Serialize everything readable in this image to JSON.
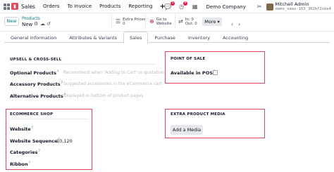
{
  "nav": {
    "app_name": "Sales",
    "menu": [
      "Orders",
      "To Invoice",
      "Products",
      "Reporting"
    ],
    "plus": "+",
    "chat_badge": "5",
    "activity_badge": "9",
    "company": "Demo Company",
    "user_name": "Mitchell Admin",
    "db_name": "demo_saas-163_302bf2cbe4"
  },
  "control": {
    "new_label": "New",
    "breadcrumb": "Products",
    "record_title": "New",
    "extra_prices_label": "Extra Prices",
    "extra_prices_count": "0",
    "website_line1": "Go to",
    "website_line2": "Website",
    "in_label": "In:",
    "in_value": "0",
    "out_label": "Out:",
    "out_value": "0",
    "more_label": "More"
  },
  "tabs": [
    "General Information",
    "Attributes & Variants",
    "Sales",
    "Purchase",
    "Inventory",
    "Accounting"
  ],
  "active_tab": "Sales",
  "upsell": {
    "title": "UPSELL & CROSS-SELL",
    "optional_label": "Optional Products",
    "optional_placeholder": "Recommend when 'Adding to Cart' or quotation",
    "accessory_label": "Accessory Products",
    "accessory_placeholder": "Suggested accessories in the eCommerce cart",
    "alternative_label": "Alternative Products",
    "alternative_placeholder": "Displayed in bottom of product pages"
  },
  "pos": {
    "title": "POINT OF SALE",
    "available_label": "Available in POS",
    "available_checked": false
  },
  "ecommerce": {
    "title": "ECOMMERCE SHOP",
    "website_label": "Website",
    "sequence_label": "Website Sequence",
    "sequence_value": "10,120",
    "categories_label": "Categories",
    "ribbon_label": "Ribbon"
  },
  "media": {
    "title": "EXTRA PRODUCT MEDIA",
    "add_label": "Add a Media"
  },
  "colors": {
    "accent": "#017e84",
    "highlight": "#e94560",
    "brand": "#e5475b"
  }
}
